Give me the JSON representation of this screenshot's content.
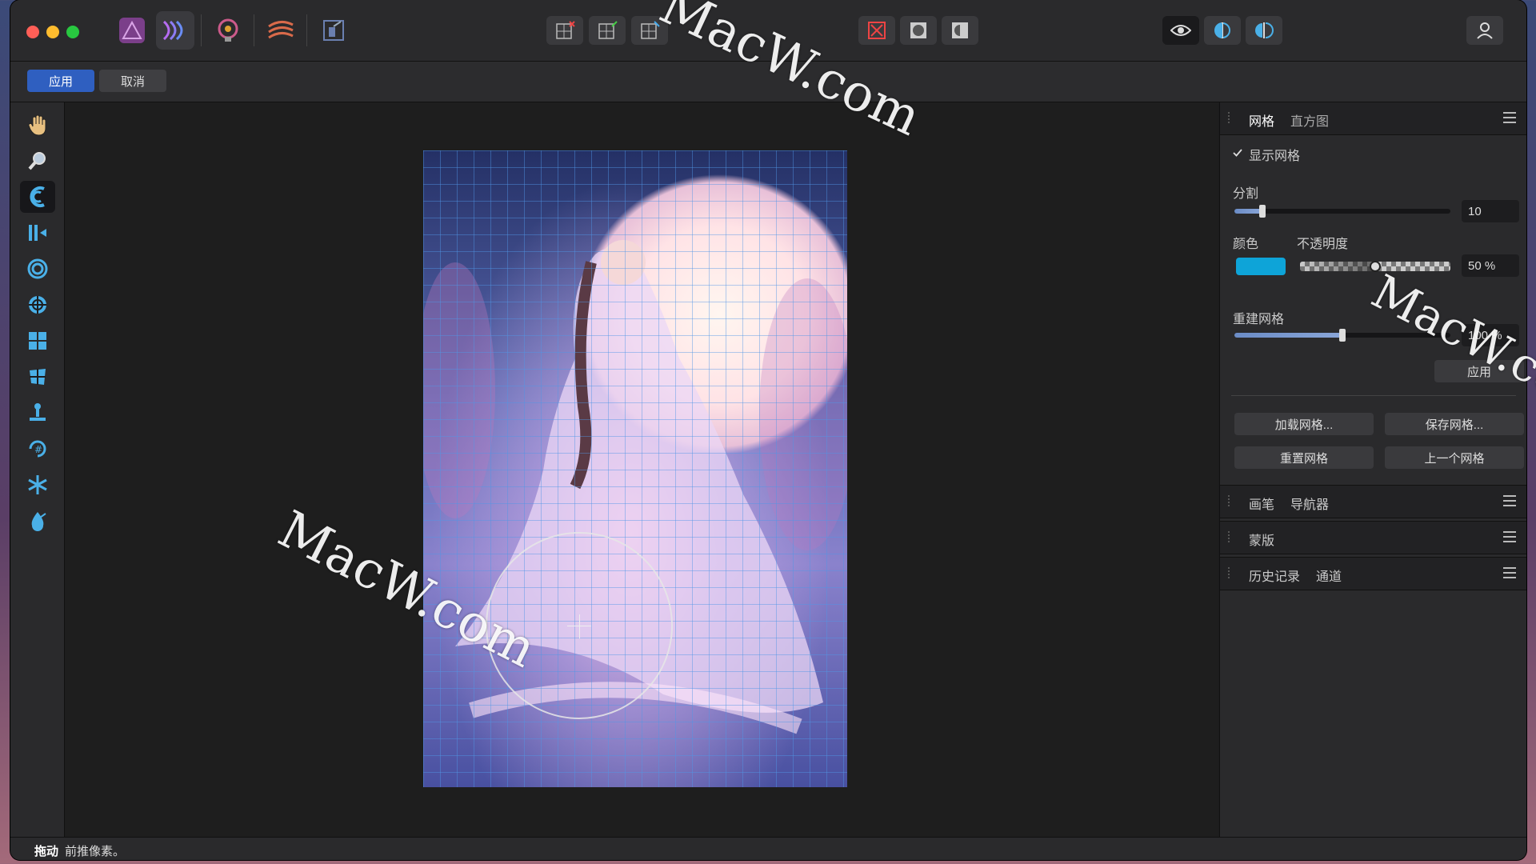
{
  "titlebar": {
    "personas": [
      "photo-persona-icon",
      "liquify-persona-icon",
      "develop-persona-icon",
      "tone-mapping-persona-icon",
      "export-persona-icon"
    ],
    "center_tools": [
      "transform-mode-icon",
      "transform-a-icon",
      "transform-b-icon"
    ],
    "view_tools": [
      "close-overlay-icon",
      "mask-mode-icon",
      "contrast-mode-icon"
    ],
    "right_tools": [
      "eye-icon",
      "split-view-icon",
      "mirror-view-icon"
    ],
    "account_icon": "user-icon"
  },
  "context": {
    "apply_label": "应用",
    "cancel_label": "取消"
  },
  "tools": [
    "hand-icon",
    "zoom-icon",
    "push-forward-icon",
    "push-left-icon",
    "twirl-icon",
    "pinch-icon",
    "grid-warp-icon",
    "turbulence-icon",
    "pin-icon",
    "clone-icon",
    "freeze-icon",
    "reconstruct-icon"
  ],
  "panel": {
    "tabs": [
      "网格",
      "直方图"
    ],
    "show_grid_label": "显示网格",
    "show_grid_checked": true,
    "divisions_label": "分割",
    "divisions_value": "10",
    "divisions_fraction": 0.13,
    "color_label": "颜色",
    "opacity_label": "不透明度",
    "opacity_value": "50 %",
    "opacity_fraction": 0.5,
    "grid_color": "#0ea4d8",
    "rebuild_label": "重建网格",
    "rebuild_value": "100 %",
    "rebuild_fraction": 0.5,
    "rebuild_apply_label": "应用",
    "load_mesh_label": "加载网格...",
    "save_mesh_label": "保存网格...",
    "reset_mesh_label": "重置网格",
    "prev_mesh_label": "上一个网格"
  },
  "collapsed_panels": [
    {
      "tabs": [
        "画笔",
        "导航器"
      ]
    },
    {
      "tabs": [
        "蒙版"
      ]
    },
    {
      "tabs": [
        "历史记录",
        "通道"
      ]
    }
  ],
  "status": {
    "bold": "拖动",
    "text": "前推像素。"
  },
  "watermarks": [
    "MacW.com",
    "MacW.com",
    "MacW.co"
  ],
  "colors": {
    "accent": "#2f5fc0",
    "window_bg": "#1c1c1e",
    "panel_bg": "#2a2a2c"
  }
}
